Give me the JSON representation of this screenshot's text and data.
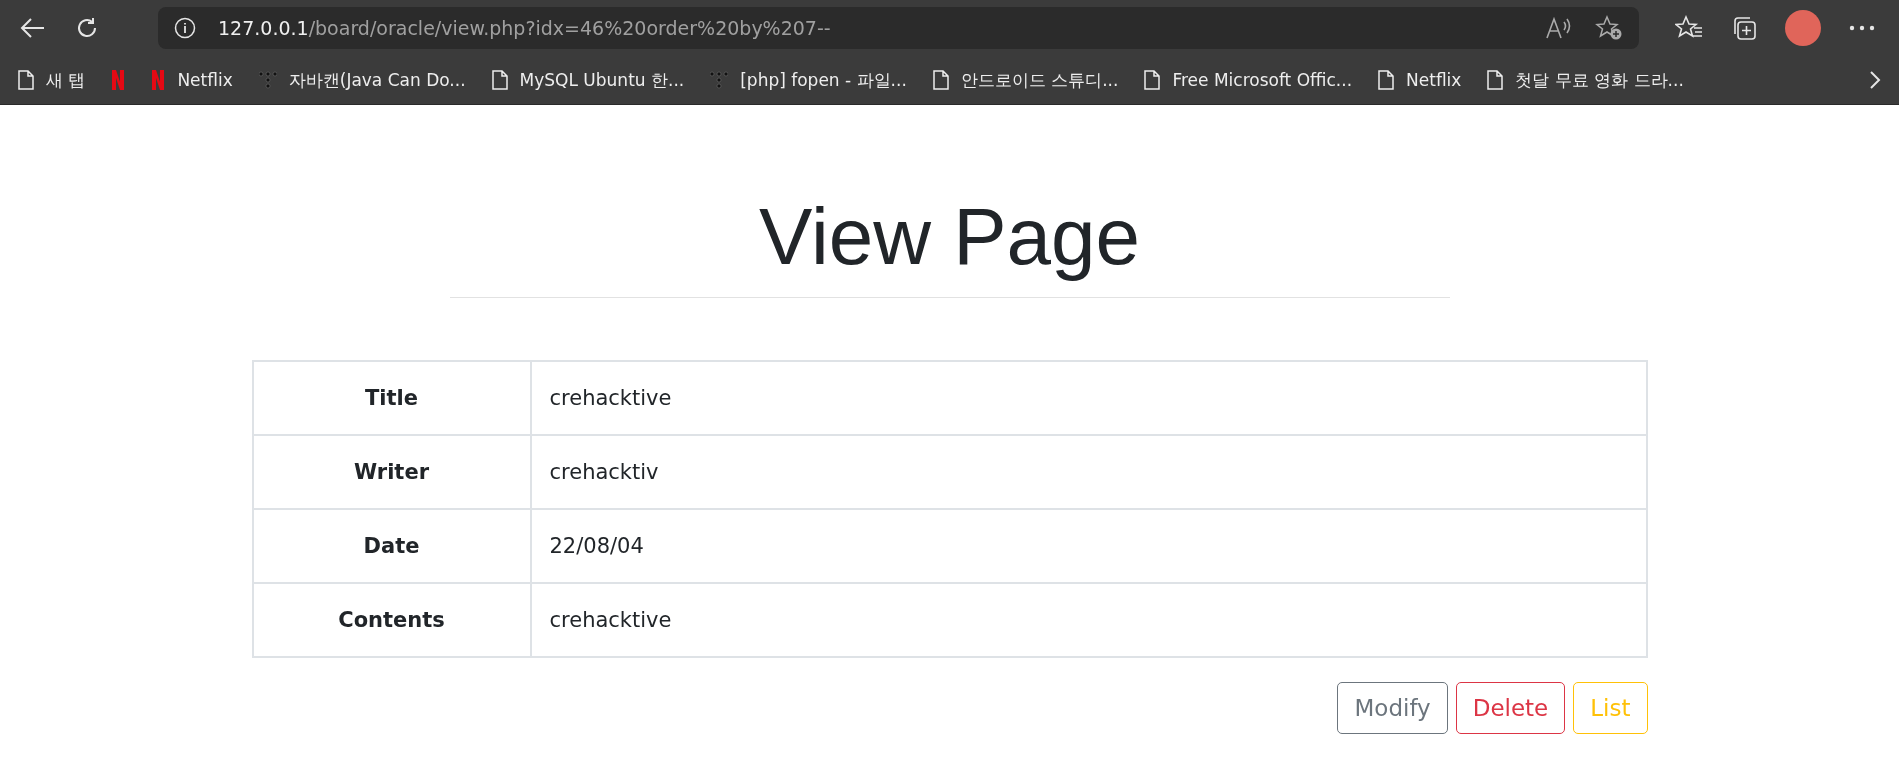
{
  "browser": {
    "address": {
      "host": "127.0.0.1",
      "path": "/board/oracle/view.php?idx=46%20order%20by%207--"
    },
    "bookmarks": [
      {
        "kind": "page",
        "label": "새 탭"
      },
      {
        "kind": "netflix"
      },
      {
        "kind": "netflix",
        "label": "Netflix"
      },
      {
        "kind": "dots",
        "label": "자바캔(Java Can Do..."
      },
      {
        "kind": "page",
        "label": "MySQL Ubuntu 한..."
      },
      {
        "kind": "dots",
        "label": "[php] fopen - 파일..."
      },
      {
        "kind": "page",
        "label": "안드로이드 스튜디..."
      },
      {
        "kind": "page",
        "label": "Free Microsoft Offic..."
      },
      {
        "kind": "page",
        "label": "Netflix"
      },
      {
        "kind": "page",
        "label": "첫달 무료 영화 드라..."
      }
    ]
  },
  "page": {
    "heading": "View Page",
    "rows": [
      {
        "label": "Title",
        "value": "crehacktive"
      },
      {
        "label": "Writer",
        "value": "crehacktiv"
      },
      {
        "label": "Date",
        "value": "22/08/04"
      },
      {
        "label": "Contents",
        "value": "crehacktive"
      }
    ],
    "buttons": [
      {
        "kind": "secondary",
        "label": "Modify"
      },
      {
        "kind": "danger",
        "label": "Delete"
      },
      {
        "kind": "warning",
        "label": "List"
      }
    ]
  }
}
